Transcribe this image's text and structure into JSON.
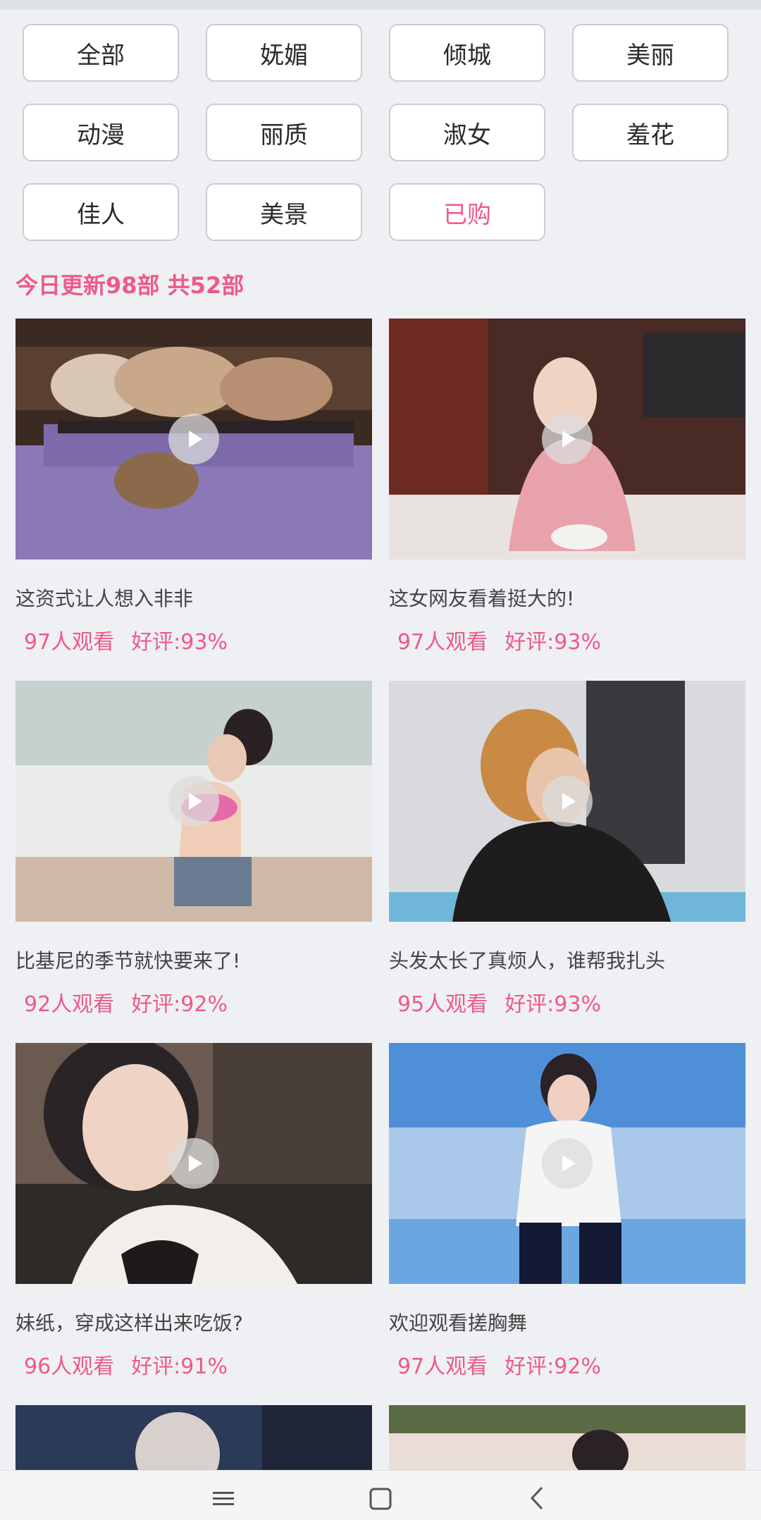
{
  "categories": [
    {
      "label": "全部"
    },
    {
      "label": "妩媚"
    },
    {
      "label": "倾城"
    },
    {
      "label": "美丽"
    },
    {
      "label": "动漫"
    },
    {
      "label": "丽质"
    },
    {
      "label": "淑女"
    },
    {
      "label": "羞花"
    },
    {
      "label": "佳人"
    },
    {
      "label": "美景"
    },
    {
      "label": "已购"
    }
  ],
  "active_category": "已购",
  "update_text": "今日更新98部 共52部",
  "videos": [
    {
      "title": "这资式让人想入非非",
      "views": "97人观看",
      "rating": "好评:93%"
    },
    {
      "title": "这女网友看着挺大的!",
      "views": "97人观看",
      "rating": "好评:93%"
    },
    {
      "title": "比基尼的季节就快要来了!",
      "views": "92人观看",
      "rating": "好评:92%"
    },
    {
      "title": "头发太长了真烦人，谁帮我扎头",
      "views": "95人观看",
      "rating": "好评:93%"
    },
    {
      "title": "妹纸，穿成这样出来吃饭?",
      "views": "96人观看",
      "rating": "好评:91%"
    },
    {
      "title": "欢迎观看搓胸舞",
      "views": "97人观看",
      "rating": "好评:92%"
    },
    {
      "title": "",
      "views": "",
      "rating": ""
    },
    {
      "title": "",
      "views": "",
      "rating": ""
    }
  ],
  "colors": {
    "accent": "#ee5a86",
    "background": "#eef0f4"
  },
  "icons": {
    "play": "play-icon",
    "nav": [
      "menu-icon",
      "home-square-icon",
      "back-chevron-icon"
    ]
  }
}
